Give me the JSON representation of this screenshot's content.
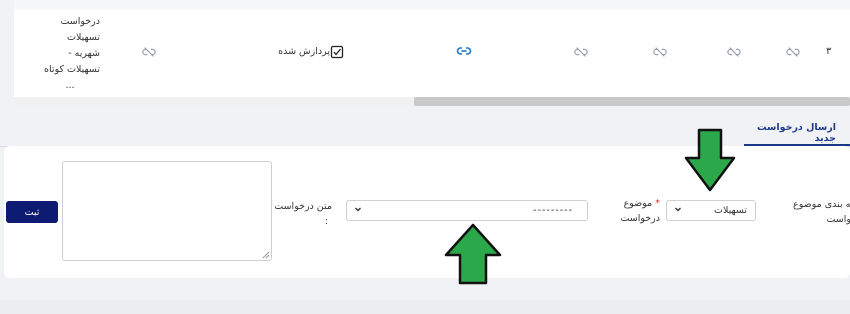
{
  "table": {
    "row": {
      "number": "۳",
      "status": "پردازش شده",
      "request_title_lines": [
        "درخواست",
        "تسهیلات",
        "شهریه -",
        "تسهیلات کوتاه",
        "..."
      ]
    }
  },
  "tabs": {
    "new_request": "ارسال درخواست جدید"
  },
  "form": {
    "category_label_lines": [
      "طبقه بندی موضوع",
      "درخواست"
    ],
    "category_value": "تسهیلات",
    "subject_label_lines": [
      "موضوع",
      "درخواست"
    ],
    "subject_required_mark": "*",
    "subject_value": "---------",
    "text_label_lines": [
      "متن درخواست",
      ":"
    ],
    "submit_label": "ثبت"
  },
  "colors": {
    "primary": "#0e1b73",
    "link": "#1976d2",
    "arrow_green": "#2aa84a",
    "required": "#d32f2f"
  }
}
